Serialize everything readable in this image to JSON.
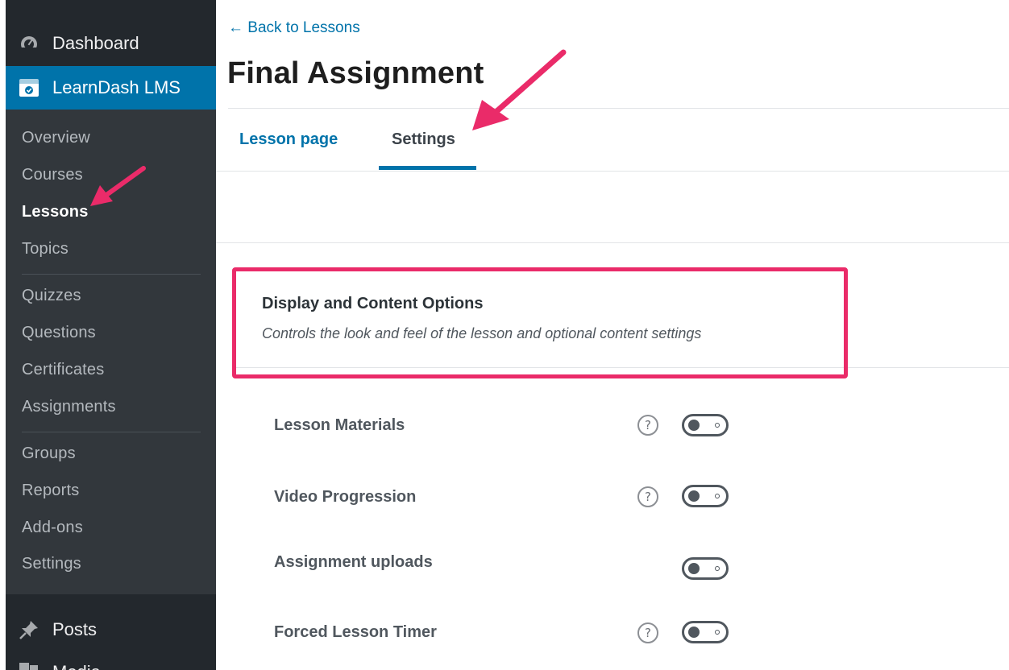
{
  "sidebar": {
    "dashboard_label": "Dashboard",
    "active_label": "LearnDash LMS",
    "items": [
      {
        "label": "Overview"
      },
      {
        "label": "Courses"
      },
      {
        "label": "Lessons"
      },
      {
        "label": "Topics"
      },
      {
        "label": "Quizzes"
      },
      {
        "label": "Questions"
      },
      {
        "label": "Certificates"
      },
      {
        "label": "Assignments"
      },
      {
        "label": "Groups"
      },
      {
        "label": "Reports"
      },
      {
        "label": "Add-ons"
      },
      {
        "label": "Settings"
      }
    ],
    "current_item": "Lessons",
    "posts_label": "Posts",
    "media_label": "Media"
  },
  "main": {
    "back_link": "← Back to Lessons",
    "title": "Final Assignment",
    "tabs": [
      {
        "label": "Lesson page",
        "active": false
      },
      {
        "label": "Settings",
        "active": true
      }
    ],
    "section": {
      "title": "Display and Content Options",
      "description": "Controls the look and feel of the lesson and optional content settings"
    },
    "options": [
      {
        "label": "Lesson Materials",
        "help": true,
        "enabled": false
      },
      {
        "label": "Video Progression",
        "help": true,
        "enabled": false
      },
      {
        "label": "Assignment uploads",
        "help": false,
        "enabled": false
      },
      {
        "label": "Forced Lesson Timer",
        "help": true,
        "enabled": false
      }
    ],
    "help_glyph": "?"
  },
  "colors": {
    "sidebar_bg": "#23282d",
    "sidebar_sub_bg": "#32373c",
    "accent": "#0073aa",
    "annotation": "#ea2b69"
  },
  "icons": [
    "dashboard-icon",
    "learndash-icon",
    "pin-icon",
    "media-icon",
    "question-icon",
    "arrow-annotation"
  ]
}
